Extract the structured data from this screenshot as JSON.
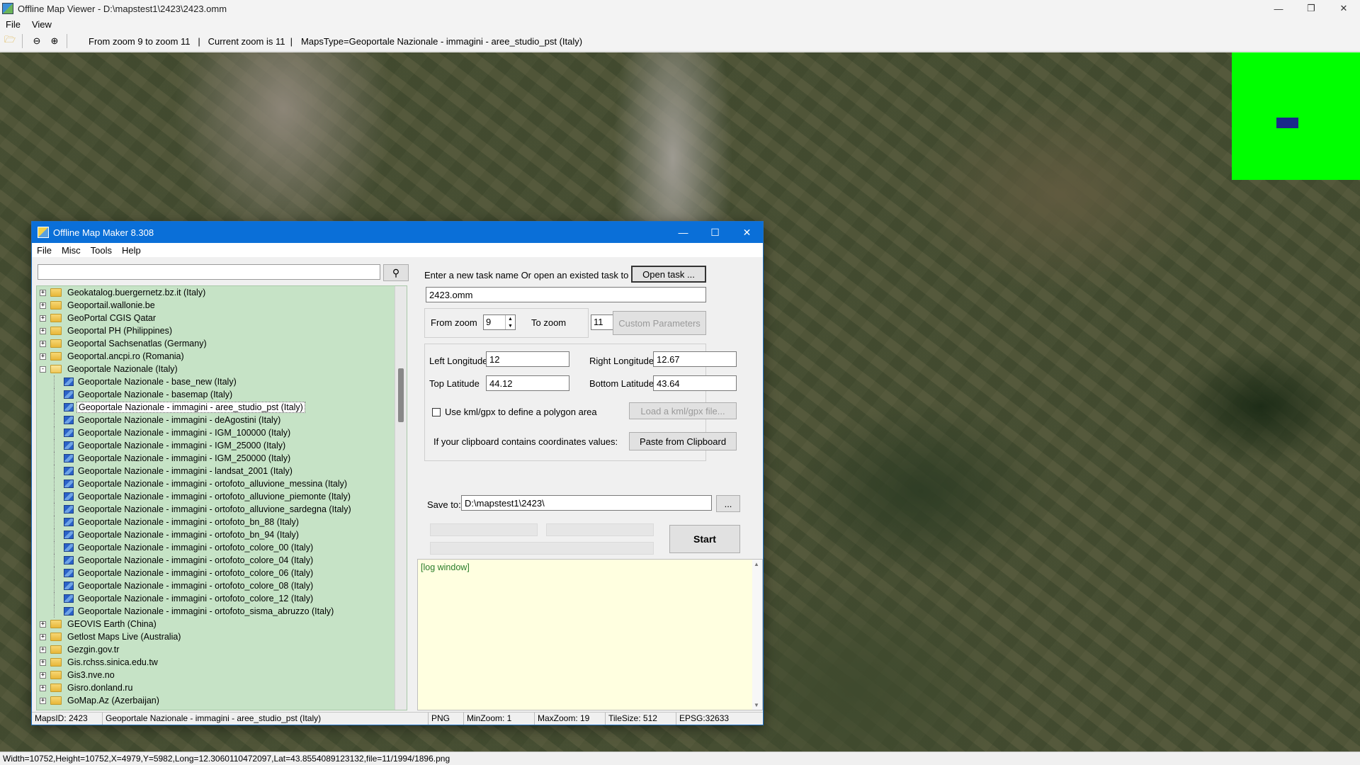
{
  "viewer": {
    "title": "Offline Map Viewer - D:\\mapstest1\\2423\\2423.omm",
    "menu": [
      "File",
      "View"
    ],
    "toolbar": {
      "zoom_range": "From zoom 9 to zoom 11   |   Current zoom is 11  |",
      "maps_type": "MapsType=Geoportale Nazionale - immagini - aree_studio_pst (Italy)"
    },
    "status": "Width=10752,Height=10752,X=4979,Y=5982,Long=12.3060110472097,Lat=43.8554089123132,file=11/1994/1896.png"
  },
  "dialog": {
    "title": "Offline Map Maker 8.308",
    "menu": [
      "File",
      "Misc",
      "Tools",
      "Help"
    ],
    "search": {
      "value": "",
      "placeholder": ""
    },
    "tree": {
      "items": [
        {
          "label": "Geokatalog.buergernetz.bz.it (Italy)",
          "level": 0,
          "expanded": false
        },
        {
          "label": "Geoportail.wallonie.be",
          "level": 0,
          "expanded": false
        },
        {
          "label": "GeoPortal CGIS Qatar",
          "level": 0,
          "expanded": false
        },
        {
          "label": "Geoportal PH (Philippines)",
          "level": 0,
          "expanded": false
        },
        {
          "label": "Geoportal Sachsenatlas (Germany)",
          "level": 0,
          "expanded": false
        },
        {
          "label": "Geoportal.ancpi.ro (Romania)",
          "level": 0,
          "expanded": false
        },
        {
          "label": "Geoportale Nazionale (Italy)",
          "level": 0,
          "expanded": true
        },
        {
          "label": "Geoportale Nazionale - base_new (Italy)",
          "level": 1
        },
        {
          "label": "Geoportale Nazionale - basemap (Italy)",
          "level": 1
        },
        {
          "label": "Geoportale Nazionale - immagini - aree_studio_pst (Italy)",
          "level": 1,
          "selected": true
        },
        {
          "label": "Geoportale Nazionale - immagini - deAgostini (Italy)",
          "level": 1
        },
        {
          "label": "Geoportale Nazionale - immagini - IGM_100000 (Italy)",
          "level": 1
        },
        {
          "label": "Geoportale Nazionale - immagini - IGM_25000 (Italy)",
          "level": 1
        },
        {
          "label": "Geoportale Nazionale - immagini - IGM_250000 (Italy)",
          "level": 1
        },
        {
          "label": "Geoportale Nazionale - immagini - landsat_2001 (Italy)",
          "level": 1
        },
        {
          "label": "Geoportale Nazionale - immagini - ortofoto_alluvione_messina (Italy)",
          "level": 1
        },
        {
          "label": "Geoportale Nazionale - immagini - ortofoto_alluvione_piemonte (Italy)",
          "level": 1
        },
        {
          "label": "Geoportale Nazionale - immagini - ortofoto_alluvione_sardegna (Italy)",
          "level": 1
        },
        {
          "label": "Geoportale Nazionale - immagini - ortofoto_bn_88 (Italy)",
          "level": 1
        },
        {
          "label": "Geoportale Nazionale - immagini - ortofoto_bn_94 (Italy)",
          "level": 1
        },
        {
          "label": "Geoportale Nazionale - immagini - ortofoto_colore_00 (Italy)",
          "level": 1
        },
        {
          "label": "Geoportale Nazionale - immagini - ortofoto_colore_04 (Italy)",
          "level": 1
        },
        {
          "label": "Geoportale Nazionale - immagini - ortofoto_colore_06 (Italy)",
          "level": 1
        },
        {
          "label": "Geoportale Nazionale - immagini - ortofoto_colore_08 (Italy)",
          "level": 1
        },
        {
          "label": "Geoportale Nazionale - immagini - ortofoto_colore_12 (Italy)",
          "level": 1
        },
        {
          "label": "Geoportale Nazionale - immagini - ortofoto_sisma_abruzzo (Italy)",
          "level": 1
        },
        {
          "label": "GEOVIS Earth (China)",
          "level": 0,
          "expanded": false
        },
        {
          "label": "Getlost Maps Live (Australia)",
          "level": 0,
          "expanded": false
        },
        {
          "label": "Gezgin.gov.tr",
          "level": 0,
          "expanded": false
        },
        {
          "label": "Gis.rchss.sinica.edu.tw",
          "level": 0,
          "expanded": false
        },
        {
          "label": "Gis3.nve.no",
          "level": 0,
          "expanded": false
        },
        {
          "label": "Gisro.donland.ru",
          "level": 0,
          "expanded": false
        },
        {
          "label": "GoMap.Az (Azerbaijan)",
          "level": 0,
          "expanded": false
        }
      ]
    },
    "task": {
      "prompt": "Enter a new task name Or open an existed task to continue:",
      "open_button": "Open task ...",
      "name": "2423.omm"
    },
    "zoom": {
      "from_label": "From zoom",
      "from_value": "9",
      "to_label": "To zoom",
      "to_value": "11",
      "custom_button": "Custom Parameters"
    },
    "coords": {
      "left_label": "Left Longitude",
      "left_value": "12",
      "right_label": "Right Longitude",
      "right_value": "12.67",
      "top_label": "Top Latitude",
      "top_value": "44.12",
      "bottom_label": "Bottom Latitude",
      "bottom_value": "43.64",
      "kml_label": "Use kml/gpx to define a polygon area",
      "kml_button": "Load a kml/gpx file...",
      "clipboard_label": "If your clipboard contains coordinates values:",
      "clipboard_button": "Paste from Clipboard"
    },
    "save": {
      "label": "Save to:",
      "path": "D:\\mapstest1\\2423\\",
      "browse_button": "...",
      "start_button": "Start"
    },
    "log": "[log window]",
    "status": {
      "maps_id": "MapsID: 2423",
      "map_name": "Geoportale Nazionale - immagini - aree_studio_pst (Italy)",
      "format": "PNG",
      "min_zoom": "MinZoom: 1",
      "max_zoom": "MaxZoom: 19",
      "tile_size": "TileSize: 512",
      "epsg": "EPSG:32633"
    }
  }
}
